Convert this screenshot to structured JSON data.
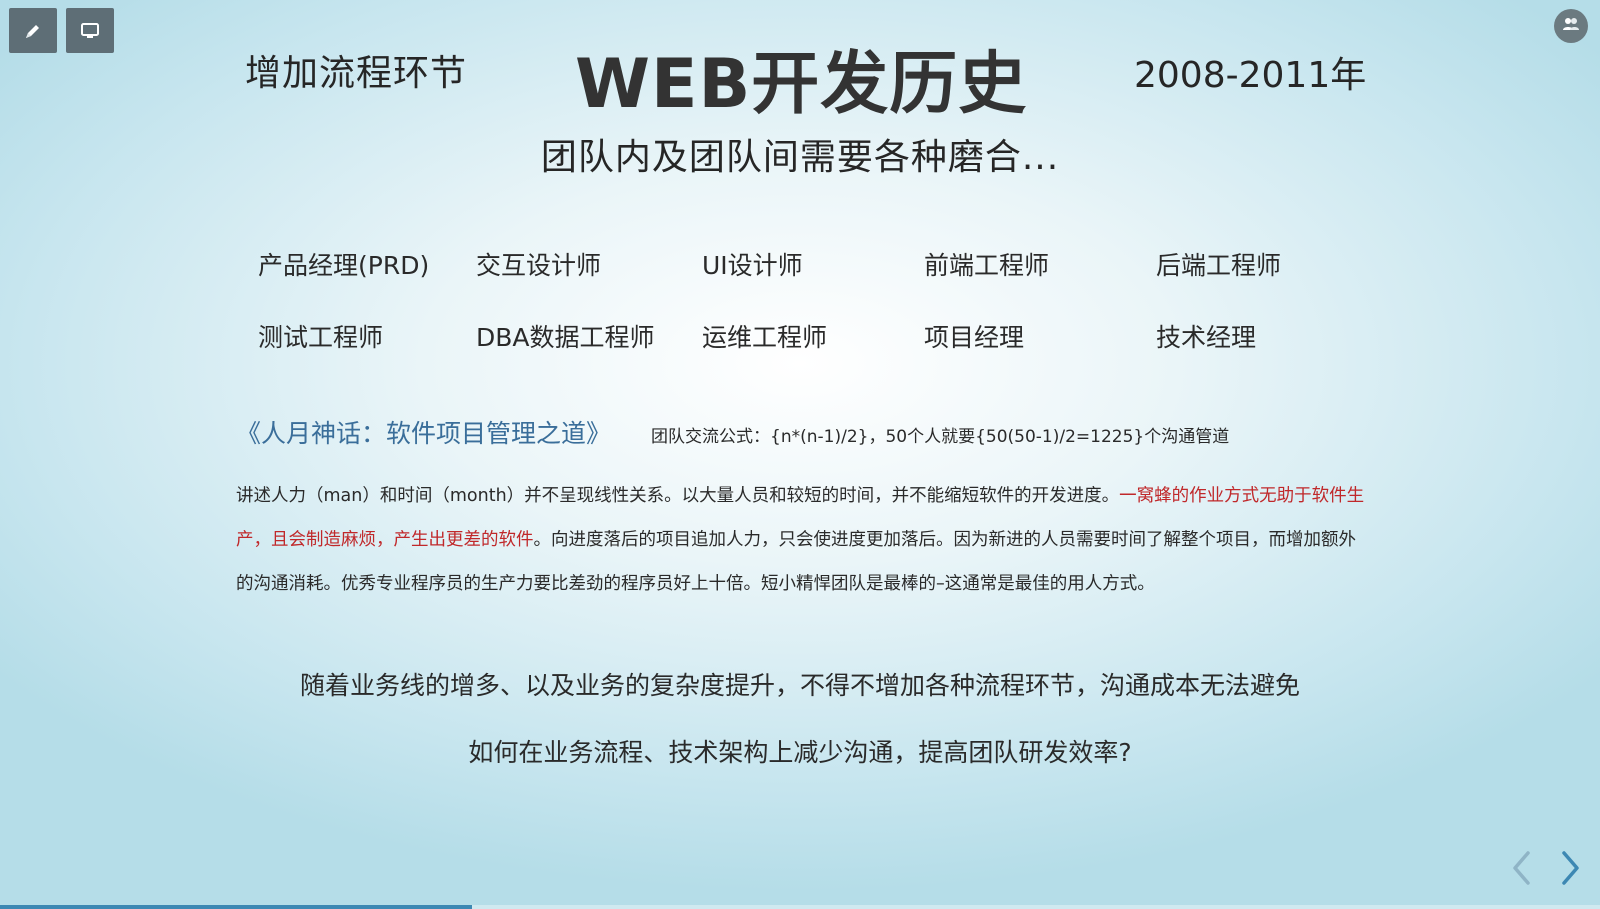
{
  "toolbar": {
    "pen_icon": "pen-icon",
    "screen_icon": "screen-icon"
  },
  "users_icon": "users-icon",
  "slide": {
    "header_left": "增加流程环节",
    "title": "WEB开发历史",
    "header_right": "2008-2011年",
    "subtitle": "团队内及团队间需要各种磨合...",
    "roles": [
      [
        "产品经理(PRD)",
        "交互设计师",
        "UI设计师",
        "前端工程师",
        "后端工程师"
      ],
      [
        "测试工程师",
        "DBA数据工程师",
        "运维工程师",
        "项目经理",
        "技术经理"
      ]
    ],
    "book_title": "《人月神话：软件项目管理之道》",
    "formula": "团队交流公式：{n*(n-1)/2}，50个人就要{50(50-1)/2=1225}个沟通管道",
    "paragraph": {
      "part1": "讲述人力（man）和时间（month）并不呈现线性关系。以大量人员和较短的时间，并不能缩短软件的开发进度。",
      "highlight": "一窝蜂的作业方式无助于软件生产，且会制造麻烦，产生出更差的软件",
      "part2": "。向进度落后的项目追加人力，只会使进度更加落后。因为新进的人员需要时间了解整个项目，而增加额外的沟通消耗。优秀专业程序员的生产力要比差劲的程序员好上十倍。短小精悍团队是最棒的–这通常是最佳的用人方式。"
    },
    "closing_1": "随着业务线的增多、以及业务的复杂度提升，不得不增加各种流程环节，沟通成本无法避免",
    "closing_2": "如何在业务流程、技术架构上减少沟通，提高团队研发效率?"
  },
  "navigation": {
    "prev_icon": "chevron-left-icon",
    "next_icon": "chevron-right-icon"
  },
  "progress": {
    "fraction": 0.295
  },
  "colors": {
    "accent_blue": "#3a6e9a",
    "highlight_red": "#c0282a",
    "progress_blue": "#3d88b3",
    "toolbar_gray": "#5e6e76"
  }
}
